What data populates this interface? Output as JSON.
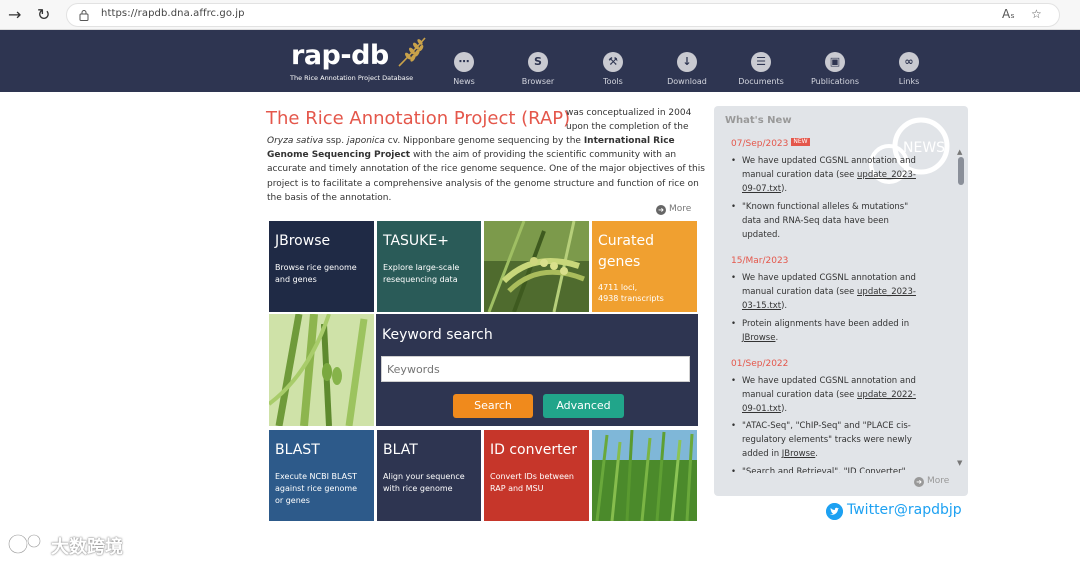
{
  "browser": {
    "url": "https://rapdb.dna.affrc.go.jp"
  },
  "header": {
    "logo_text": "rap-db",
    "logo_sub": "The Rice Annotation Project Database",
    "nav": [
      {
        "label": "News",
        "icon": "chat-icon"
      },
      {
        "label": "Browser",
        "icon": "browser-icon"
      },
      {
        "label": "Tools",
        "icon": "tools-icon"
      },
      {
        "label": "Download",
        "icon": "download-icon"
      },
      {
        "label": "Documents",
        "icon": "documents-icon"
      },
      {
        "label": "Publications",
        "icon": "publications-icon"
      },
      {
        "label": "Links",
        "icon": "links-icon"
      }
    ]
  },
  "intro": {
    "title": "The Rice Annotation Project (RAP)",
    "line1": "was conceptualized in 2004",
    "line2": "upon the completion of the",
    "line3a_italic": "Oryza sativa",
    "line3b": " ssp. ",
    "line3c_italic": "japonica",
    "line3d": " cv. Nipponbare genome sequencing by the ",
    "line3e_bold": "International Rice",
    "line4a_bold": "Genome Sequencing Project",
    "line4b": " with the aim of providing the scientific community with an",
    "line5": "accurate and timely annotation of the rice genome sequence. One of the major objectives of this",
    "line6": "project is to facilitate a comprehensive analysis of the genome structure and function of rice on",
    "line7": "the basis of the annotation.",
    "more": "More"
  },
  "tiles": {
    "jbrowse": {
      "title": "JBrowse",
      "desc1": "Browse rice genome",
      "desc2": "and genes"
    },
    "tasuke": {
      "title": "TASUKE+",
      "desc1": "Explore large-scale",
      "desc2": "resequencing data"
    },
    "curated": {
      "title1": "Curated",
      "title2": "genes",
      "desc1": "4711 loci,",
      "desc2": "4938 transcripts"
    },
    "blast": {
      "title": "BLAST",
      "desc1": "Execute NCBI BLAST",
      "desc2": "against rice genome",
      "desc3": "or genes"
    },
    "blat": {
      "title": "BLAT",
      "desc1": "Align your sequence",
      "desc2": "with rice genome"
    },
    "idconv": {
      "title": "ID converter",
      "desc1": "Convert IDs between",
      "desc2": "RAP and MSU"
    }
  },
  "keyword_search": {
    "title": "Keyword search",
    "placeholder": "Keywords",
    "search_label": "Search",
    "advanced_label": "Advanced"
  },
  "news": {
    "heading": "What's New",
    "badge": "NEW",
    "watermark": "NEWS",
    "more": "More",
    "entries": [
      {
        "date": "07/Sep/2023",
        "items": [
          {
            "l1": "We have updated CGSNL annotation and",
            "l2a": "manual curation data (see ",
            "l2b": "update_2023-",
            "l3a": "09-07.txt",
            "l3b": ")."
          },
          {
            "l1": "\"Known functional alleles & mutations\"",
            "l2": "data and RNA-Seq data have been",
            "l3": "updated."
          }
        ]
      },
      {
        "date": "15/Mar/2023",
        "items": [
          {
            "l1": "We have updated CGSNL annotation and",
            "l2a": "manual curation data (see ",
            "l2b": "update_2023-",
            "l3a": "03-15.txt",
            "l3b": ")."
          },
          {
            "l1": "Protein alignments have been added in",
            "l2a": "JBrowse",
            "l2b": "."
          }
        ]
      },
      {
        "date": "01/Sep/2022",
        "items": [
          {
            "l1": "We have updated CGSNL annotation and",
            "l2a": "manual curation data (see ",
            "l2b": "update_2022-",
            "l3a": "09-01.txt",
            "l3b": ")."
          },
          {
            "l1": "\"ATAC-Seq\", \"ChIP-Seq\" and \"PLACE cis-",
            "l2": "regulatory elements\" tracks were newly",
            "l3a": "added in ",
            "l3b": "JBrowse",
            "l3c": "."
          },
          {
            "l1": "\"Search and Retrieval\", \"ID Converter\""
          }
        ]
      }
    ]
  },
  "twitter": "Twitter@rapdbjp",
  "watermark": "大数跨境",
  "colors": {
    "header_bg": "#2e3551",
    "accent_red": "#e4574b",
    "jbrowse": "#1f2a45",
    "tasuke": "#2a5b58",
    "curated": "#f0a030",
    "blast": "#2d5a8a",
    "blat": "#2e3551",
    "idconv": "#c6362a",
    "search_btn": "#f08a1c",
    "advanced_btn": "#21a58a",
    "twitter": "#1da1f2"
  }
}
